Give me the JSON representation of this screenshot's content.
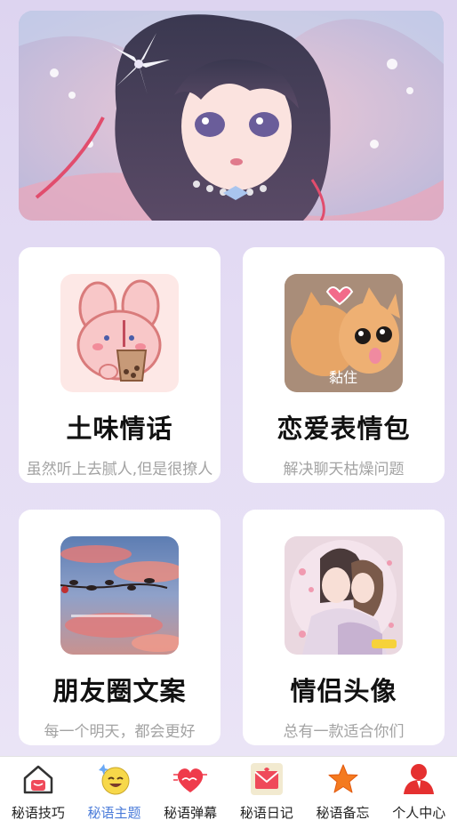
{
  "banner": {
    "alt": "anime girl illustration"
  },
  "cards": [
    {
      "title": "土味情话",
      "subtitle": "虽然听上去腻人,但是很撩人",
      "icon": "bunny-milktea-icon"
    },
    {
      "title": "恋爱表情包",
      "subtitle": "解决聊天枯燥问题",
      "icon": "kitten-sticker-image",
      "overlay": "黏住"
    },
    {
      "title": "朋友圈文案",
      "subtitle": "每一个明天，都会更好",
      "icon": "sunset-sky-image"
    },
    {
      "title": "情侣头像",
      "subtitle": "总有一款适合你们",
      "icon": "couple-avatar-image"
    }
  ],
  "nav": {
    "items": [
      {
        "label": "秘语技巧",
        "icon": "house-icon"
      },
      {
        "label": "秘语主题",
        "icon": "smiley-face-icon",
        "active": true
      },
      {
        "label": "秘语弹幕",
        "icon": "heart-icon"
      },
      {
        "label": "秘语日记",
        "icon": "envelope-icon"
      },
      {
        "label": "秘语备忘",
        "icon": "star-icon"
      },
      {
        "label": "个人中心",
        "icon": "person-icon"
      }
    ],
    "active_color": "#4a7bd9"
  }
}
